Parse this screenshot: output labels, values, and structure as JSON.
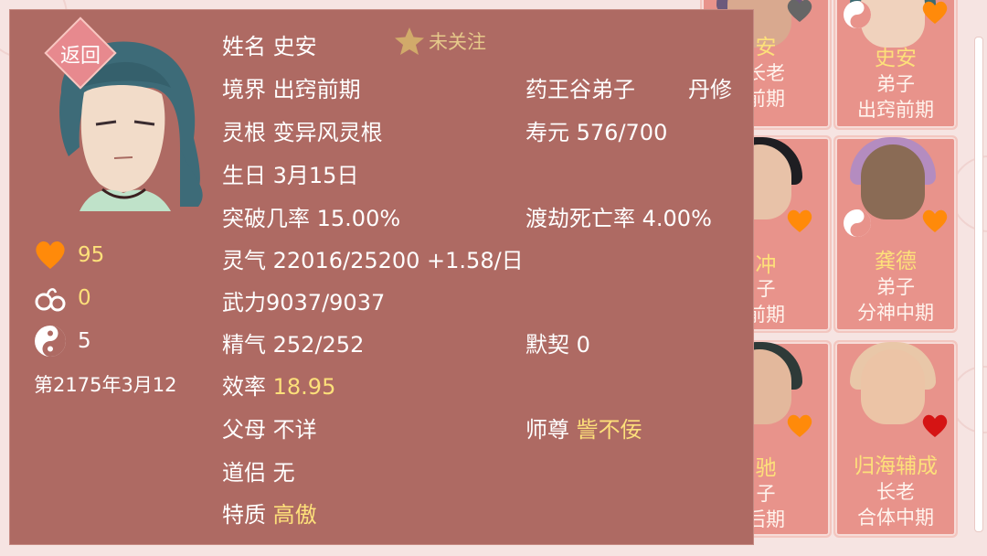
{
  "colors": {
    "panel_bg": "#ae6a63",
    "highlight": "#fde07a",
    "card_bg": "#e8938b",
    "heart_orange": "#ff8a0a",
    "heart_red": "#d51414",
    "heart_gray": "#666666"
  },
  "panel": {
    "back_label": "返回",
    "follow_label": "未关注",
    "stats": {
      "favor": "95",
      "cuffs": "0",
      "yinyang": "5"
    },
    "date": "第2175年3月12",
    "fields": {
      "name_key": "姓名",
      "name_val": "史安",
      "realm_key": "境界",
      "realm_val": "出窍前期",
      "sect_val": "药王谷弟子",
      "path_val": "丹修",
      "root_key": "灵根",
      "root_val": "变异风灵根",
      "life_key": "寿元",
      "life_val": "576/700",
      "birthday_key": "生日",
      "birthday_val": "3月15日",
      "breakthrough_key": "突破几率",
      "breakthrough_val": "15.00%",
      "tribulation_key": "渡劫死亡率",
      "tribulation_val": "4.00%",
      "qi_key": "灵气",
      "qi_val": "22016/25200 +1.58/日",
      "martial_key": "武力",
      "martial_val": "9037/9037",
      "essence_key": "精气",
      "essence_val": "252/252",
      "bond_key": "默契",
      "bond_val": "0",
      "eff_key": "效率",
      "eff_val": "18.95",
      "parents_key": "父母",
      "parents_val": "不详",
      "master_key": "师尊",
      "master_val": "訾不佞",
      "partner_key": "道侣",
      "partner_val": "无",
      "trait_key": "特质",
      "trait_val": "高傲"
    }
  },
  "roster": [
    {
      "name": "史安",
      "role": "弟子",
      "rank": "出窍前期",
      "heart": "orange"
    },
    {
      "name": "龚德",
      "role": "弟子",
      "rank": "分神中期",
      "heart": "orange"
    },
    {
      "name": "归海辅成",
      "role": "长老",
      "rank": "合体中期",
      "heart": "red"
    }
  ],
  "roster_partial": [
    {
      "name": "安",
      "role": "长老",
      "rank": "前期",
      "heart": "gray"
    },
    {
      "name": "冲",
      "role": "子",
      "rank": "前期",
      "heart": "orange"
    },
    {
      "name": "驰",
      "role": "子",
      "rank": "后期",
      "heart": "orange"
    }
  ]
}
